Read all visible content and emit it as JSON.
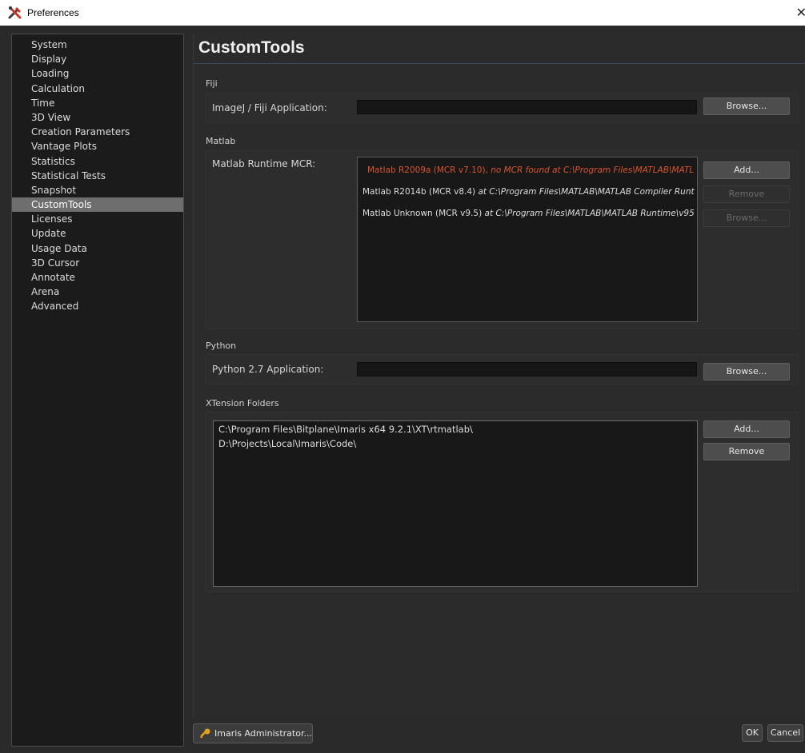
{
  "window": {
    "title": "Preferences",
    "close_glyph": "✕"
  },
  "sidebar": {
    "items": [
      {
        "label": "System"
      },
      {
        "label": "Display"
      },
      {
        "label": "Loading"
      },
      {
        "label": "Calculation"
      },
      {
        "label": "Time"
      },
      {
        "label": "3D View"
      },
      {
        "label": "Creation Parameters"
      },
      {
        "label": "Vantage Plots"
      },
      {
        "label": "Statistics"
      },
      {
        "label": "Statistical Tests"
      },
      {
        "label": "Snapshot"
      },
      {
        "label": "CustomTools",
        "active": true
      },
      {
        "label": "Licenses"
      },
      {
        "label": "Update"
      },
      {
        "label": "Usage Data"
      },
      {
        "label": "3D Cursor"
      },
      {
        "label": "Annotate"
      },
      {
        "label": "Arena"
      },
      {
        "label": "Advanced"
      }
    ]
  },
  "page": {
    "title": "CustomTools"
  },
  "fiji": {
    "section": "Fiji",
    "label": "ImageJ / Fiji Application:",
    "value": "",
    "browse": "Browse..."
  },
  "matlab": {
    "section": "Matlab",
    "label": "Matlab Runtime MCR:",
    "items": [
      {
        "name": "Matlab R2009a (MCR v7.10),",
        "detail": " no MCR found at C:\\Program Files\\MATLAB\\MATL",
        "error": true
      },
      {
        "name": "Matlab R2014b (MCR v8.4)",
        "detail": " at C:\\Program Files\\MATLAB\\MATLAB Compiler Runt",
        "error": false
      },
      {
        "name": "Matlab Unknown (MCR v9.5)",
        "detail": " at C:\\Program Files\\MATLAB\\MATLAB Runtime\\v95",
        "error": false
      }
    ],
    "add": "Add...",
    "remove": "Remove",
    "browse": "Browse..."
  },
  "python": {
    "section": "Python",
    "label": "Python 2.7 Application:",
    "value": "",
    "browse": "Browse..."
  },
  "xtension": {
    "section": "XTension Folders",
    "items": [
      "C:\\Program Files\\Bitplane\\Imaris x64 9.2.1\\XT\\rtmatlab\\",
      "D:\\Projects\\Local\\Imaris\\Code\\"
    ],
    "add": "Add...",
    "remove": "Remove"
  },
  "footer": {
    "admin": "Imaris Administrator...",
    "ok": "OK",
    "cancel": "Cancel"
  },
  "colors": {
    "accent_active": "#6e6e6e",
    "error_text": "#d9542f"
  }
}
